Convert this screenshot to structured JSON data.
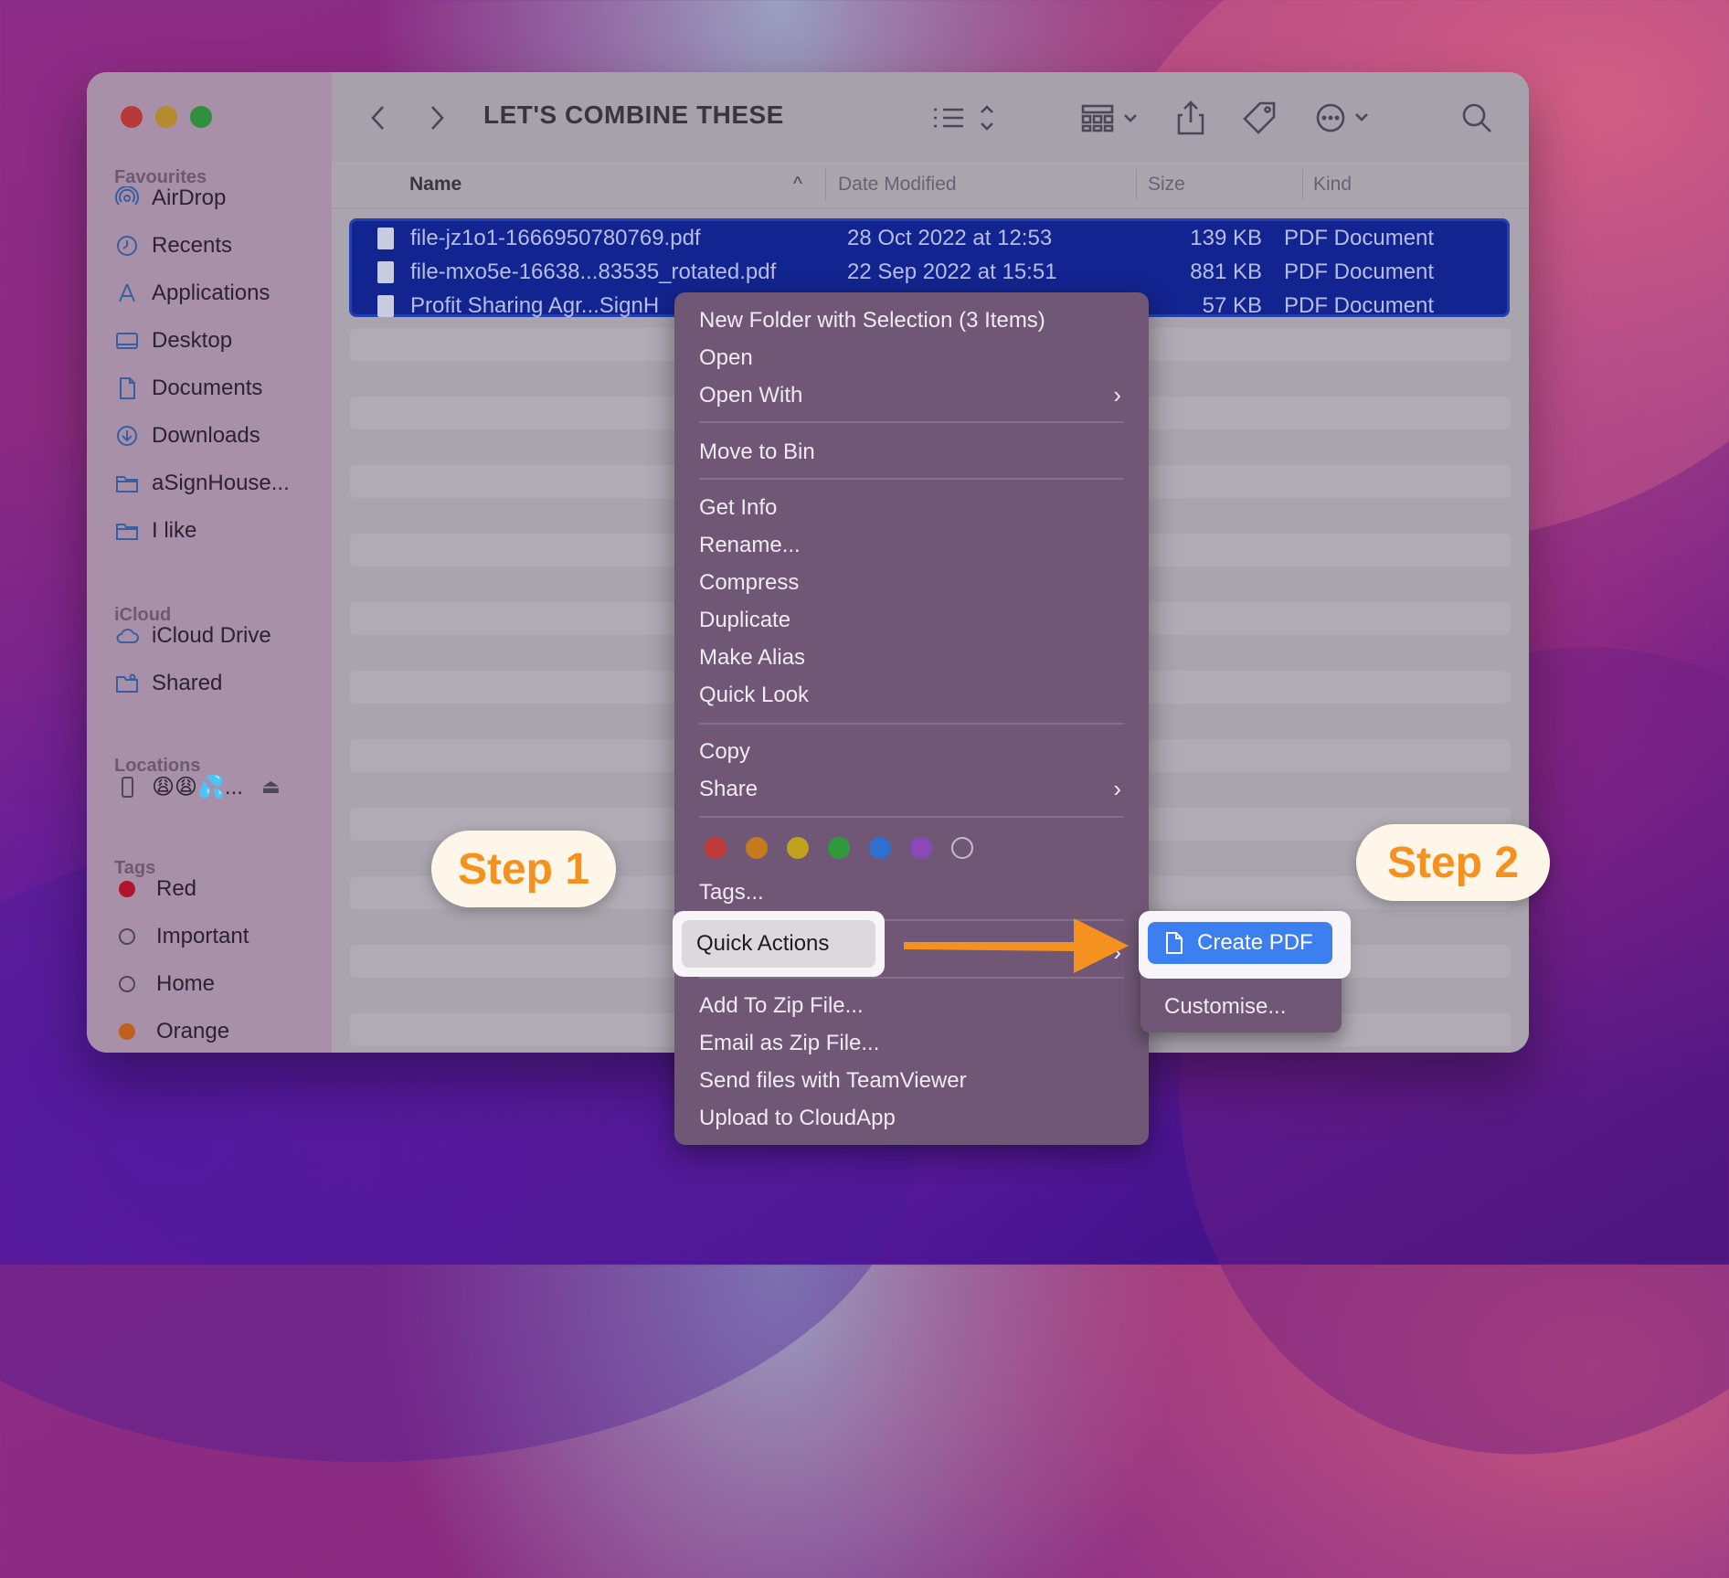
{
  "window": {
    "title": "LET'S COMBINE THESE"
  },
  "sidebar": {
    "favourites_heading": "Favourites",
    "favourites": [
      {
        "label": "AirDrop",
        "icon": "airdrop-icon"
      },
      {
        "label": "Recents",
        "icon": "clock-icon"
      },
      {
        "label": "Applications",
        "icon": "applications-icon"
      },
      {
        "label": "Desktop",
        "icon": "desktop-icon"
      },
      {
        "label": "Documents",
        "icon": "document-icon"
      },
      {
        "label": "Downloads",
        "icon": "download-icon"
      },
      {
        "label": "aSignHouse...",
        "icon": "folder-icon"
      },
      {
        "label": "I like",
        "icon": "folder-icon"
      }
    ],
    "icloud_heading": "iCloud",
    "icloud": [
      {
        "label": "iCloud Drive",
        "icon": "cloud-icon"
      },
      {
        "label": "Shared",
        "icon": "shared-folder-icon"
      }
    ],
    "locations_heading": "Locations",
    "locations": [
      {
        "label": "😩😩💦...",
        "icon": "phone-icon"
      }
    ],
    "tags_heading": "Tags",
    "tags": [
      {
        "label": "Red",
        "color": "#b3132b"
      },
      {
        "label": "Important",
        "color": ""
      },
      {
        "label": "Home",
        "color": ""
      },
      {
        "label": "Orange",
        "color": "#c0601c"
      }
    ]
  },
  "columns": {
    "name": "Name",
    "date": "Date Modified",
    "size": "Size",
    "kind": "Kind"
  },
  "files": [
    {
      "name": "file-jz1o1-1666950780769.pdf",
      "date": "28 Oct 2022 at 12:53",
      "size": "139 KB",
      "kind": "PDF Document"
    },
    {
      "name": "file-mxo5e-16638...83535_rotated.pdf",
      "date": "22 Sep 2022 at 15:51",
      "size": "881 KB",
      "kind": "PDF Document"
    },
    {
      "name": "Profit Sharing Agr...SignH",
      "date": "",
      "size": "57 KB",
      "kind": "PDF Document"
    }
  ],
  "context_menu": {
    "items": [
      "New Folder with Selection (3 Items)",
      "Open",
      "Open With",
      "Move to Bin",
      "Get Info",
      "Rename...",
      "Compress",
      "Duplicate",
      "Make Alias",
      "Quick Look",
      "Copy",
      "Share",
      "Tags...",
      "Quick Actions",
      "Add To Zip File...",
      "Email as Zip File...",
      "Send files with TeamViewer",
      "Upload to CloudApp"
    ],
    "tag_colors": [
      "#c03a3a",
      "#c57a1e",
      "#c2a020",
      "#2f9a3c",
      "#2e6fd0",
      "#8a48b8",
      ""
    ]
  },
  "submenu": {
    "create_pdf": "Create PDF",
    "customise": "Customise..."
  },
  "annotations": {
    "step1": "Step 1",
    "step2": "Step 2",
    "arrow_color": "#f5911e"
  }
}
